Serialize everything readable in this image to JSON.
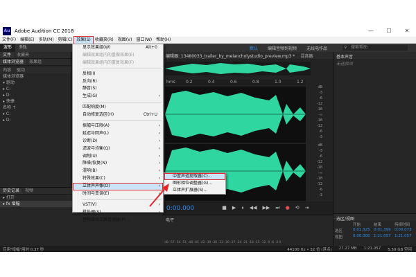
{
  "window": {
    "title": "Adobe Audition CC 2018",
    "icon_text": "Au",
    "controls": [
      "—",
      "☐",
      "✕"
    ]
  },
  "menubar": [
    "文件(F)",
    "编辑(E)",
    "多轨(M)",
    "剪辑(C)",
    "效果(S)",
    "收藏夹(R)",
    "视图(V)",
    "窗口(W)",
    "帮助(H)"
  ],
  "toolbar": {
    "modes": [
      "波形",
      "多轨"
    ],
    "workspaces": [
      "默认",
      "编辑音频到视频",
      "无线电作品"
    ],
    "search_placeholder": "搜索帮助"
  },
  "leftpanel": {
    "tabs": [
      "文件",
      "收藏夹",
      "媒体浏览器",
      "效果组"
    ],
    "subtabs": [
      "内容",
      "驱动"
    ],
    "rows": [
      "媒体浏览器",
      "▾ 驱动",
      "  ▸ C:",
      "  ▸ D:",
      "▸ 快捷",
      "名称 ↑",
      "  ▸ C:",
      "  ▸ D:"
    ]
  },
  "history": {
    "tabs": [
      "历史记录",
      "视频"
    ],
    "rows": [
      "▸ 打开",
      "▸ fx 增幅"
    ],
    "footer": "1撤销"
  },
  "editor": {
    "tabs": [
      "编辑器: 13480033_trailer_by_melancholystudio_preview.mp3 *",
      "混音器"
    ],
    "ruler": [
      "hms",
      "0.2",
      "0.4",
      "0.6",
      "0.8",
      "1.0",
      "1.2"
    ],
    "db_labels": [
      "dB",
      "-3",
      "-6",
      "-12",
      "-18",
      "-∞",
      "-18",
      "-12",
      "-6",
      "-3",
      "dB",
      "-3",
      "-6",
      "-12",
      "-18",
      "-∞",
      "-18",
      "-12",
      "-6",
      "-3"
    ],
    "timecode": "0:00.000",
    "transport": [
      "■",
      "▶",
      "⏸",
      "◀◀",
      "▶▶",
      "⏭",
      "●",
      "⟲",
      "⇥"
    ]
  },
  "level": {
    "label": "电平",
    "scale": "dB -57 -54 -51 -48 -45 -42 -39 -36 -33 -30 -27 -24 -21 -18 -15 -12 -9 -6 -3 0"
  },
  "rightpanel": {
    "header": "基本声音",
    "sub": "无选择项",
    "selection_title": "选区/视图",
    "selection_headers": [
      "",
      "开始",
      "结束",
      "持续时间"
    ],
    "selection_rows": [
      [
        "选区",
        "0:01.325",
        "0:01.399",
        "0:00.073"
      ],
      [
        "视图",
        "0:00.000",
        "1:21.057",
        "1:21.057"
      ]
    ]
  },
  "status": {
    "left": "应用\"增幅\"用时 0.37 秒",
    "right": [
      "44100 Hz • 32 位 (浮点)",
      "27.27 MB",
      "1:21.057",
      "5.59 GB 空闲"
    ]
  },
  "dropdown": {
    "items": [
      {
        "label": "显示效果组(W)",
        "shortcut": "Alt+0"
      },
      {
        "label": "编辑效果组内的重做效果(E)",
        "disabled": true
      },
      {
        "label": "编辑效果组内的重复效果(F)",
        "disabled": true
      },
      {
        "sep": true
      },
      {
        "label": "反相(I)"
      },
      {
        "label": "反向(R)"
      },
      {
        "label": "静音(S)"
      },
      {
        "label": "生成(G)",
        "sub": true
      },
      {
        "sep": true
      },
      {
        "label": "匹配响度(M)"
      },
      {
        "label": "自动修复选区(H)",
        "shortcut": "Ctrl+U"
      },
      {
        "sep": true
      },
      {
        "label": "振幅与压限(A)",
        "sub": true
      },
      {
        "label": "延迟与回声(L)",
        "sub": true
      },
      {
        "label": "诊断(D)",
        "sub": true
      },
      {
        "label": "滤波与均衡(Q)",
        "sub": true
      },
      {
        "label": "调制(U)",
        "sub": true
      },
      {
        "label": "降噪/恢复(N)",
        "sub": true
      },
      {
        "label": "混响(B)",
        "sub": true
      },
      {
        "label": "特殊效果(C)",
        "sub": true
      },
      {
        "label": "立体声声像(O)",
        "sub": true,
        "highlight": true
      },
      {
        "label": "时间与变调(E)",
        "sub": true
      },
      {
        "sep": true
      },
      {
        "label": "VST(V)",
        "sub": true
      },
      {
        "label": "批处理(S)",
        "sub": true
      },
      {
        "label": "音频增效工具管理器(P)..."
      }
    ]
  },
  "submenu": {
    "items": [
      {
        "label": "中置声道提取器(C)...",
        "highlight": true
      },
      {
        "label": "图形相位调整器(G)..."
      },
      {
        "label": "立体声扩展器(S)..."
      }
    ]
  },
  "colors": {
    "waveform": "#2fd6a0",
    "accent": "#2d8ceb",
    "highlight_border": "#e0282b"
  }
}
